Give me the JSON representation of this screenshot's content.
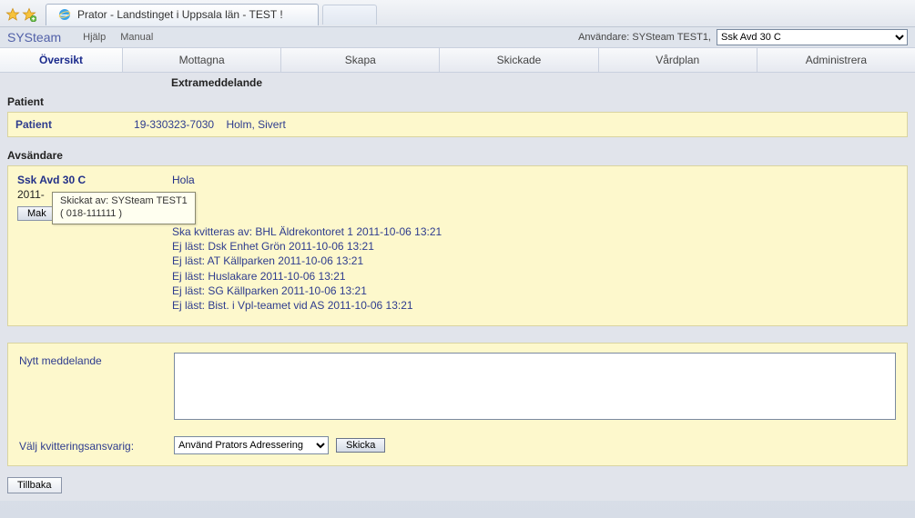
{
  "browser": {
    "tab_title": "Prator - Landstinget i Uppsala län - TEST !"
  },
  "header": {
    "brand": "SYSteam",
    "help": "Hjälp",
    "manual": "Manual",
    "user_label": "Användare: SYSteam TEST1,",
    "location": "Ssk Avd 30 C"
  },
  "tabs": {
    "overview": "Översikt",
    "received": "Mottagna",
    "create": "Skapa",
    "sent": "Skickade",
    "careplan": "Vårdplan",
    "admin": "Administrera"
  },
  "subheading": "Extrameddelande",
  "patient_section": {
    "label": "Patient",
    "key": "Patient",
    "id": "19-330323-7030",
    "name": "Holm,  Sivert"
  },
  "sender_section": {
    "label": "Avsändare",
    "name": "Ssk Avd 30 C",
    "datetime_partial": "2011-",
    "mak_button": "Mak",
    "tooltip_line1": "Skickat av: SYSteam TEST1",
    "tooltip_line2": "( 018-111111 )",
    "message": "Hola",
    "lines": [
      "Ska kvitteras av: BHL Äldrekontoret 1 2011-10-06 13:21",
      "Ej läst: Dsk Enhet Grön 2011-10-06 13:21",
      "Ej läst: AT Källparken 2011-10-06 13:21",
      "Ej läst: Huslakare 2011-10-06 13:21",
      "Ej läst: SG Källparken 2011-10-06 13:21",
      "Ej läst: Bist. i Vpl-teamet vid AS 2011-10-06 13:21"
    ]
  },
  "compose": {
    "new_label": "Nytt meddelande",
    "responsible_label": "Välj kvitteringsansvarig:",
    "addressing_option": "Använd Prators Adressering",
    "send": "Skicka"
  },
  "back": "Tillbaka"
}
